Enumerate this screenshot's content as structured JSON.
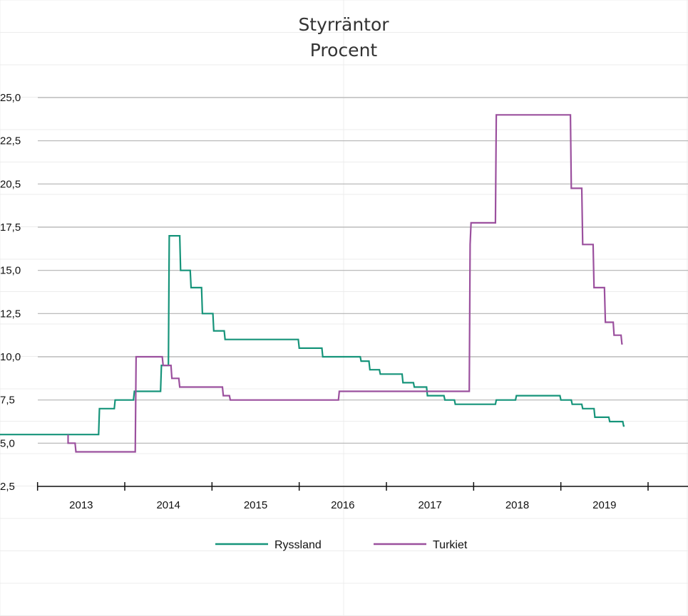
{
  "chart_data": {
    "type": "line",
    "title": "Styrräntor",
    "subtitle": "Procent",
    "xlabel": "",
    "ylabel": "",
    "ylim": [
      2.5,
      25.0
    ],
    "xlim": [
      2012.5,
      2019.9
    ],
    "y_ticks": [
      "25,0",
      "22,5",
      "20,5",
      "17,5",
      "15,0",
      "12,5",
      "10,0",
      "7,5",
      "5,0",
      "2,5"
    ],
    "x_ticks": [
      "2013",
      "2014",
      "2015",
      "2016",
      "2017",
      "2018",
      "2019"
    ],
    "grid": true,
    "legend_position": "bottom",
    "series": [
      {
        "name": "Ryssland",
        "color": "#16947a",
        "x": [
          2012.55,
          2013.7,
          2013.71,
          2013.88,
          2013.89,
          2014.1,
          2014.11,
          2014.41,
          2014.42,
          2014.5,
          2014.51,
          2014.63,
          2014.64,
          2014.75,
          2014.76,
          2014.88,
          2014.89,
          2015.01,
          2015.02,
          2015.14,
          2015.15,
          2015.99,
          2016.0,
          2016.26,
          2016.27,
          2016.7,
          2016.71,
          2016.8,
          2016.81,
          2016.92,
          2016.93,
          2017.18,
          2017.19,
          2017.31,
          2017.32,
          2017.46,
          2017.47,
          2017.66,
          2017.67,
          2017.78,
          2017.79,
          2018.25,
          2018.26,
          2018.48,
          2018.49,
          2018.99,
          2019.0,
          2019.12,
          2019.13,
          2019.24,
          2019.25,
          2019.38,
          2019.39,
          2019.55,
          2019.56,
          2019.71,
          2019.72,
          2019.73
        ],
        "y": [
          5.5,
          5.5,
          7.0,
          7.0,
          7.5,
          7.5,
          8.0,
          8.0,
          9.5,
          9.5,
          17.0,
          17.0,
          15.0,
          15.0,
          14.0,
          14.0,
          12.5,
          12.5,
          11.5,
          11.5,
          11.0,
          11.0,
          10.5,
          10.5,
          10.0,
          10.0,
          9.75,
          9.75,
          9.25,
          9.25,
          9.0,
          9.0,
          8.5,
          8.5,
          8.25,
          8.25,
          7.75,
          7.75,
          7.5,
          7.5,
          7.25,
          7.25,
          7.5,
          7.5,
          7.75,
          7.75,
          7.5,
          7.5,
          7.25,
          7.25,
          7.0,
          7.0,
          6.5,
          6.5,
          6.25,
          6.25,
          6.0,
          6.0
        ]
      },
      {
        "name": "Turkiet",
        "color": "#9b509e",
        "x": [
          2013.35,
          2013.35,
          2013.43,
          2013.44,
          2014.12,
          2014.13,
          2014.43,
          2014.44,
          2014.53,
          2014.54,
          2014.62,
          2014.63,
          2015.12,
          2015.13,
          2015.2,
          2015.21,
          2016.45,
          2016.46,
          2017.95,
          2017.96,
          2017.97,
          2018.25,
          2018.26,
          2019.11,
          2019.12,
          2019.24,
          2019.25,
          2019.37,
          2019.38,
          2019.5,
          2019.51,
          2019.6,
          2019.61,
          2019.69,
          2019.7,
          2019.71
        ],
        "y": [
          5.5,
          5.0,
          5.0,
          4.5,
          4.5,
          10.0,
          10.0,
          9.5,
          9.5,
          8.75,
          8.75,
          8.25,
          8.25,
          7.75,
          7.75,
          7.5,
          7.5,
          8.0,
          8.0,
          16.5,
          17.75,
          17.75,
          24.0,
          24.0,
          19.75,
          19.75,
          16.5,
          16.5,
          14.0,
          14.0,
          12.0,
          12.0,
          11.25,
          11.25,
          10.75,
          10.75
        ]
      }
    ]
  }
}
